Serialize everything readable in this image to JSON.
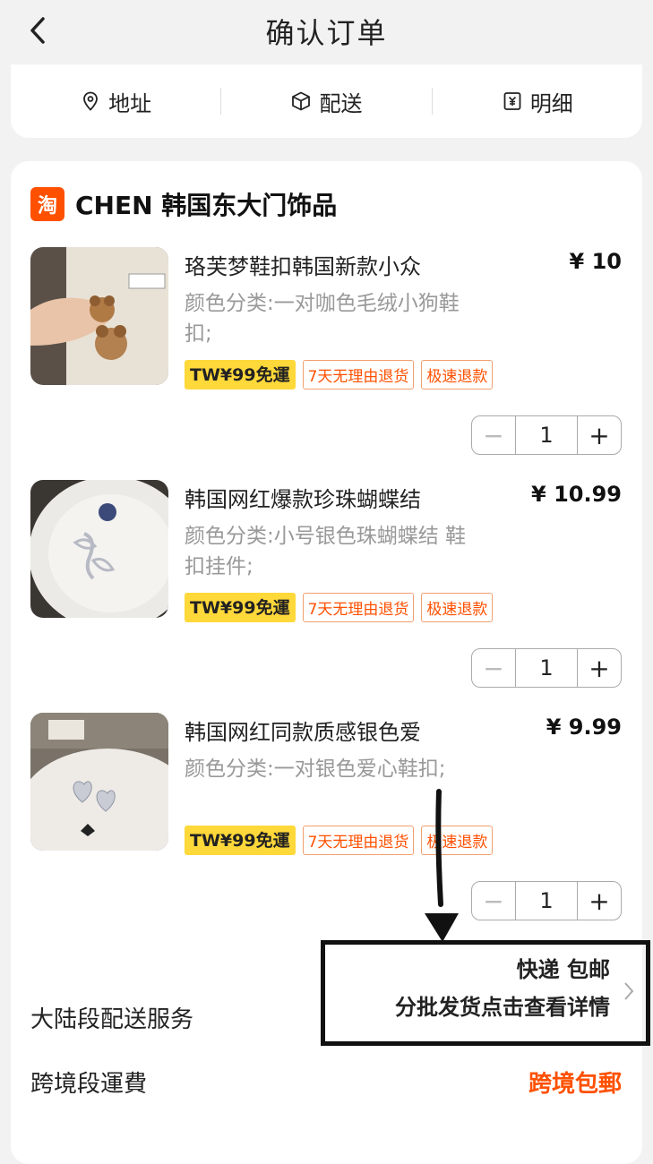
{
  "header": {
    "title": "确认订单"
  },
  "tabs": [
    {
      "label": "地址",
      "icon": "location-icon"
    },
    {
      "label": "配送",
      "icon": "package-icon"
    },
    {
      "label": "明细",
      "icon": "yen-receipt-icon"
    }
  ],
  "shop": {
    "logo_text": "淘",
    "name": "CHEN 韩国东大门饰品"
  },
  "items": [
    {
      "title": "珞芙梦鞋扣韩国新款小众",
      "price": "¥ 10",
      "spec": "颜色分类:一对咖色毛绒小狗鞋扣;",
      "tags": [
        "TW¥99免運",
        "7天无理由退货",
        "极速退款"
      ],
      "quantity": "1"
    },
    {
      "title": "韩国网红爆款珍珠蝴蝶结",
      "price": "¥ 10.99",
      "spec": "颜色分类:小号银色珠蝴蝶结 鞋扣挂件;",
      "tags": [
        "TW¥99免運",
        "7天无理由退货",
        "极速退款"
      ],
      "quantity": "1"
    },
    {
      "title": "韩国网红同款质感银色爱",
      "price": "¥ 9.99",
      "spec": "颜色分类:一对银色爱心鞋扣;",
      "tags": [
        "TW¥99免運",
        "7天无理由退货",
        "极速退款"
      ],
      "quantity": "1"
    }
  ],
  "stepper": {
    "minus": "−",
    "plus": "+"
  },
  "service": {
    "label": "大陆段配送服务",
    "line1": "快递 包邮",
    "line2": "分批发货点击查看详情"
  },
  "cross_border": {
    "label": "跨境段運費",
    "value": "跨境包郵"
  },
  "colors": {
    "accent": "#ff5000",
    "tag_yellow": "#ffd83a",
    "background": "#f2f2f2"
  }
}
